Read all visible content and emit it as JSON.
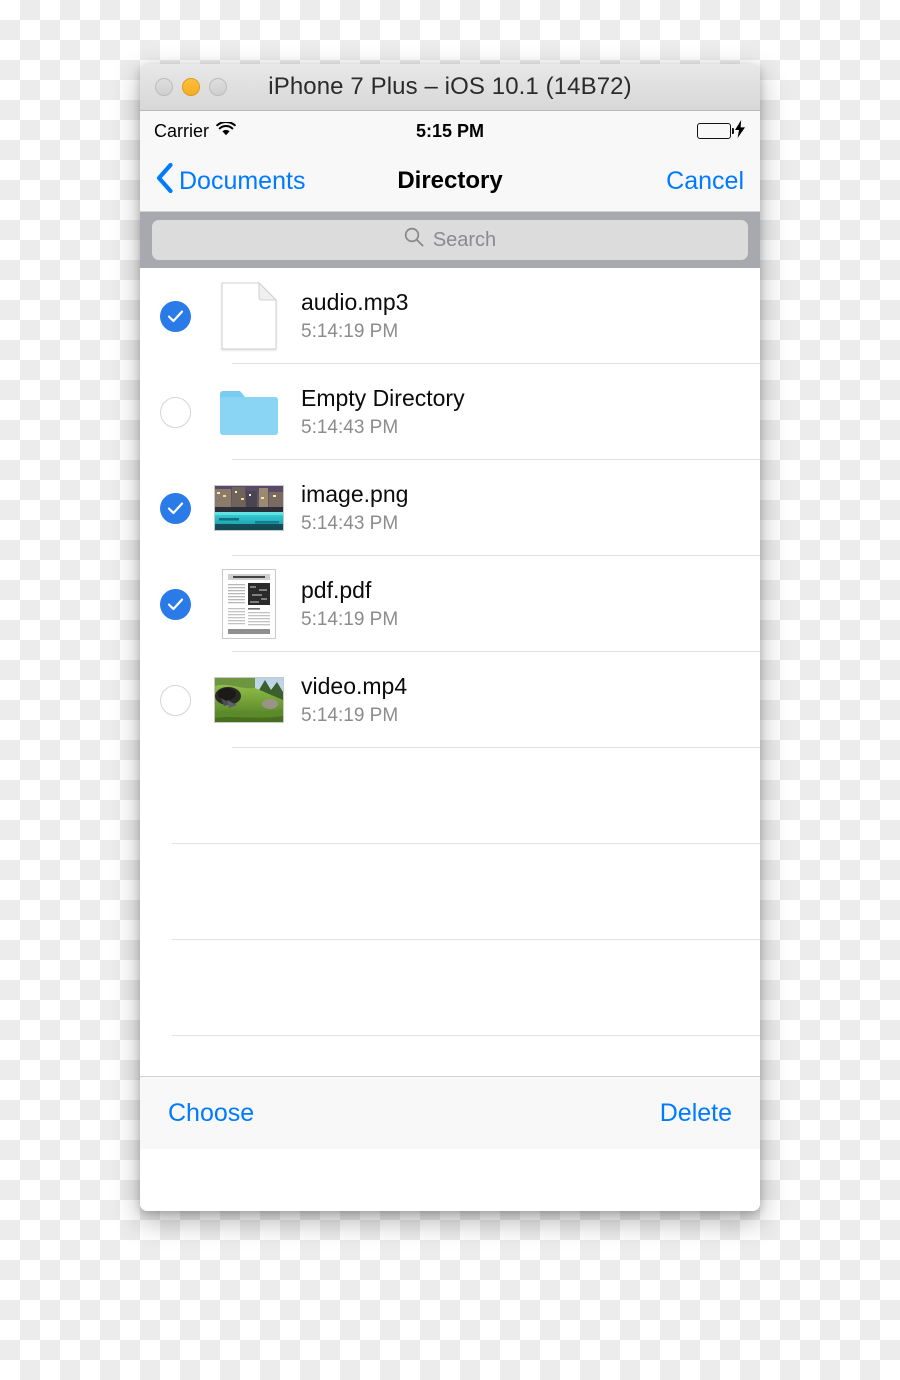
{
  "window": {
    "title": "iPhone 7 Plus – iOS 10.1 (14B72)",
    "buttons": [
      {
        "name": "close",
        "color": "#d6d6d6",
        "enabled": false
      },
      {
        "name": "minimize",
        "color": "#fbbd2e",
        "enabled": true
      },
      {
        "name": "zoom",
        "color": "#d6d6d6",
        "enabled": false
      }
    ]
  },
  "status_bar": {
    "carrier": "Carrier",
    "wifi_icon": "wifi-icon",
    "time": "5:15 PM",
    "battery_icon": "battery-full-icon",
    "battery_color": "#4cd964",
    "charging_icon": "lightning-bolt-icon"
  },
  "nav_bar": {
    "back_icon": "chevron-left-icon",
    "back_label": "Documents",
    "title": "Directory",
    "cancel_label": "Cancel",
    "tint_color": "#007aff"
  },
  "search": {
    "icon": "search-icon",
    "placeholder": "Search",
    "value": ""
  },
  "list": {
    "items": [
      {
        "name": "audio.mp3",
        "timestamp": "5:14:19 PM",
        "checked": true,
        "icon": "generic-document-icon",
        "kind": "document"
      },
      {
        "name": "Empty Directory",
        "timestamp": "5:14:43 PM",
        "checked": false,
        "icon": "folder-icon",
        "kind": "folder"
      },
      {
        "name": "image.png",
        "timestamp": "5:14:43 PM",
        "checked": true,
        "icon": "photo-thumbnail",
        "kind": "image"
      },
      {
        "name": "pdf.pdf",
        "timestamp": "5:14:19 PM",
        "checked": true,
        "icon": "pdf-page-thumbnail",
        "kind": "pdf"
      },
      {
        "name": "video.mp4",
        "timestamp": "5:14:19 PM",
        "checked": false,
        "icon": "video-thumbnail",
        "kind": "video"
      }
    ],
    "blank_row_count": 4,
    "checked_color": "#2a7ae8",
    "unchecked_border_color": "#d4d4d6"
  },
  "toolbar": {
    "choose_label": "Choose",
    "delete_label": "Delete",
    "tint_color": "#007aff"
  }
}
